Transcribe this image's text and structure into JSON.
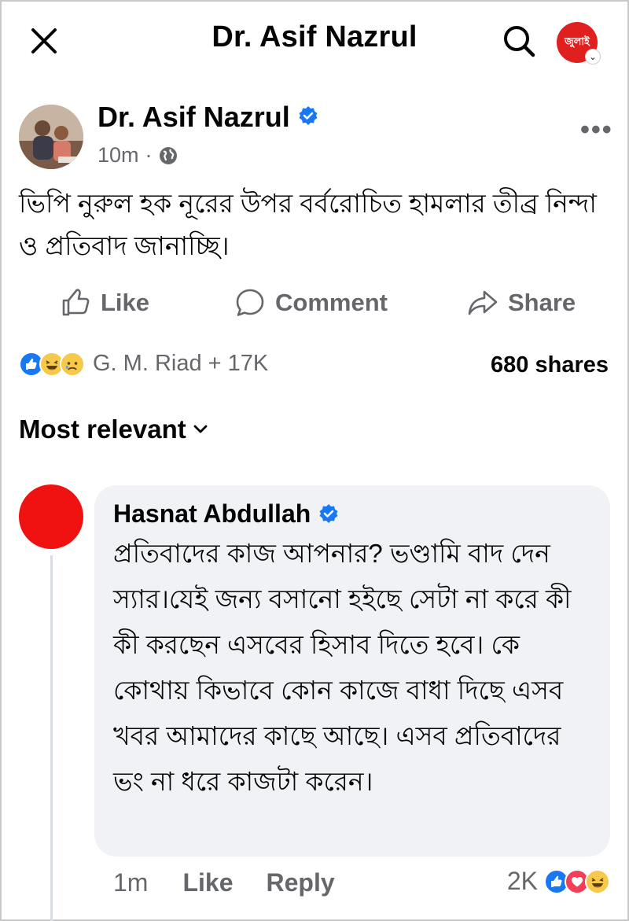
{
  "header": {
    "title": "Dr. Asif Nazrul",
    "badge_text": "জুলাই",
    "icons": [
      "close-icon",
      "search-icon"
    ]
  },
  "post": {
    "author": "Dr. Asif Nazrul",
    "time": "10m",
    "separator": "·",
    "text": "ভিপি নুরুল হক নূরের উপর বর্বরোচিত হামলার তীব্র নিন্দা ও প্রতিবাদ জানাচ্ছি।",
    "more": "•••"
  },
  "actions": {
    "like": "Like",
    "comment": "Comment",
    "share": "Share"
  },
  "reactions": {
    "summary": "G. M. Riad + 17K",
    "shares": "680 shares"
  },
  "filter": {
    "label": "Most relevant"
  },
  "comment": {
    "author": "Hasnat Abdullah",
    "text": "প্রতিবাদের কাজ আপনার? ভণ্ডামি বাদ দেন স্যার।যেই জন্য বসানো হইছে সেটা না করে কী কী করছেন এসবের হিসাব দিতে হবে। কে কোথায় কিভাবে কোন কাজে বাধা দিছে এসব খবর আমাদের কাছে আছে। এসব প্রতিবাদের ভং না ধরে কাজটা করেন।",
    "time": "1m",
    "like": "Like",
    "reply": "Reply",
    "reaction_count": "2K"
  },
  "colors": {
    "accent": "#1877f2",
    "muted": "#65676b",
    "bubble": "#f0f2f5",
    "comment_avatar": "#f01111"
  }
}
